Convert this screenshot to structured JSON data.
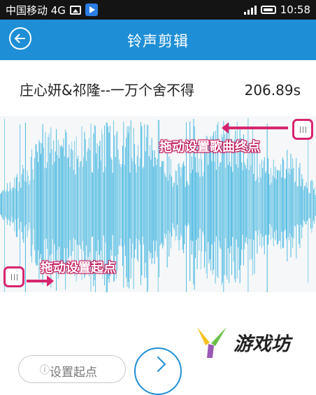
{
  "status_bar": {
    "carrier": "中国移动 4G",
    "time": "10:58",
    "icons": [
      "image-icon",
      "play-app-icon",
      "signal-icon",
      "battery-icon"
    ]
  },
  "header": {
    "title": "铃声剪辑",
    "back_icon": "back-arrow-circle-icon",
    "color": "#1e8fd6"
  },
  "song": {
    "name": "庄心妍&祁隆--一万个舍不得",
    "duration": "206.89s"
  },
  "waveform": {
    "color": "#3cb4e0",
    "end_annotation": "拖动设置歌曲终点",
    "start_annotation": "拖动设置起点",
    "annotation_color": "#d7256e"
  },
  "controls": {
    "set_start_label": "设置起点",
    "play_icon": "play-icon"
  },
  "watermark": {
    "text": "游戏坊",
    "logo": "y-logo-icon"
  }
}
